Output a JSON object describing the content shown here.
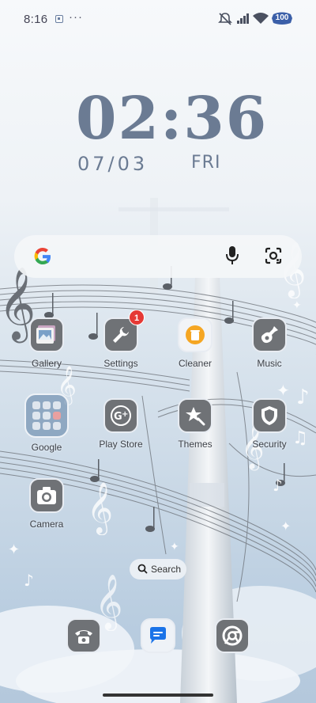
{
  "status_bar": {
    "time": "8:16",
    "dots": "···",
    "battery_level": "100",
    "icons": [
      "notification-icon",
      "mute-icon",
      "signal-icon",
      "wifi-icon",
      "battery-icon"
    ]
  },
  "lock_clock": {
    "time": "02:36",
    "date": "07/03",
    "day": "FRI"
  },
  "search_widget": {
    "icons": [
      "google-logo-icon",
      "microphone-icon",
      "google-lens-icon"
    ]
  },
  "apps": [
    {
      "label": "Gallery",
      "icon": "gallery-icon"
    },
    {
      "label": "Settings",
      "icon": "wrench-icon",
      "badge": "1"
    },
    {
      "label": "Cleaner",
      "icon": "trash-can-icon"
    },
    {
      "label": "Music",
      "icon": "guitar-icon"
    },
    {
      "label": "Google",
      "icon": "folder-icon"
    },
    {
      "label": "Play Store",
      "icon": "google-plus-icon"
    },
    {
      "label": "Themes",
      "icon": "star-brush-icon"
    },
    {
      "label": "Security",
      "icon": "shield-icon"
    },
    {
      "label": "Camera",
      "icon": "camera-icon"
    }
  ],
  "app_search": {
    "label": "Search"
  },
  "dock": [
    {
      "icon": "phone-icon"
    },
    {
      "icon": "messages-icon"
    },
    {
      "icon": "chrome-icon"
    }
  ],
  "colors": {
    "clock": "#6b7b93",
    "icon_bg": "#6f7276",
    "badge": "#e53935",
    "battery": "#3b5fa8"
  }
}
